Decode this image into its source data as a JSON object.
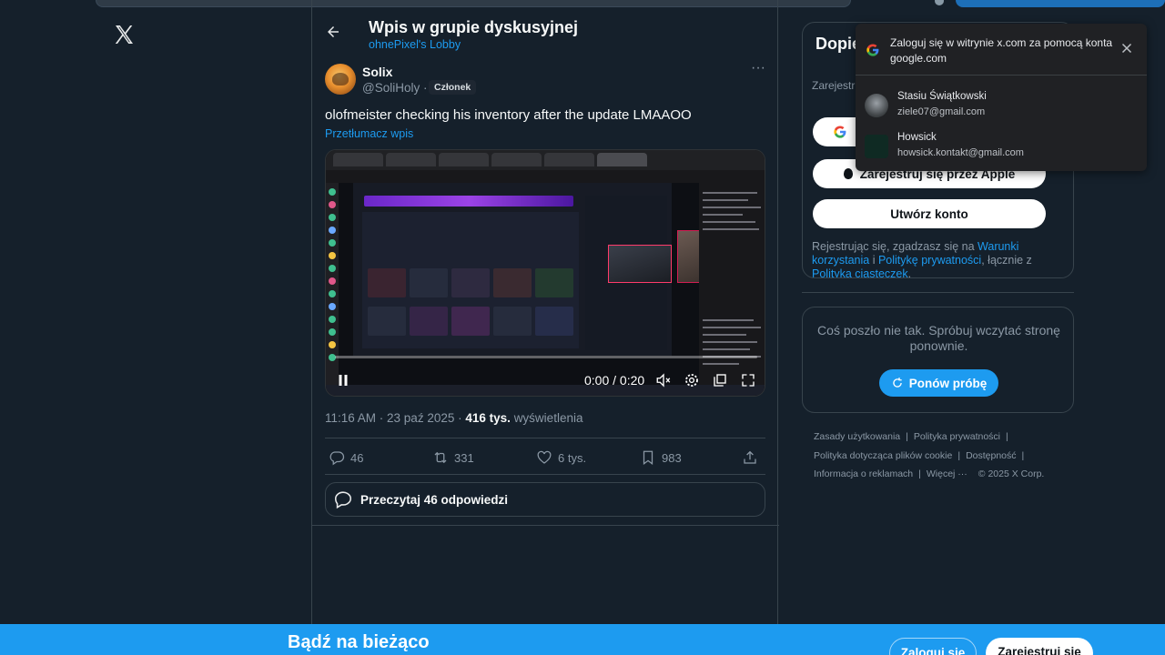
{
  "header": {
    "title": "Wpis w grupie dyskusyjnej",
    "subtitle": "ohnePixel's Lobby"
  },
  "tweet": {
    "author_name": "Solix",
    "author_handle": "@SoliHoly ·",
    "badge": "Członek",
    "text": "olofmeister checking his inventory after the update LMAAOO",
    "translate": "Przetłumacz wpis",
    "video": {
      "time": "0:00 / 0:20"
    },
    "timestamp": "11:16 AM · 23 paź 2025 ·",
    "views_count": "416 tys.",
    "views_label": "wyświetlenia",
    "actions": {
      "replies": "46",
      "reposts": "331",
      "likes": "6 tys.",
      "bookmarks": "983"
    },
    "read_replies": "Przeczytaj 46 odpowiedzi"
  },
  "signup": {
    "title": "Dopie serwi",
    "subtitle": "Zarejestr spersona",
    "apple_label": "Zarejestruj się przez Apple",
    "create_label": "Utwórz konto",
    "terms_prefix": "Rejestrując się, zgadzasz się na ",
    "terms_link1": "Warunki korzystania",
    "terms_mid1": " i ",
    "terms_link2": "Politykę prywatności",
    "terms_mid2": ", łącznie z ",
    "terms_link3": "Polityką ciasteczek",
    "terms_end": "."
  },
  "error_card": {
    "message": "Coś poszło nie tak. Spróbuj wczytać stronę ponownie.",
    "retry_label": "Ponów próbę"
  },
  "footer": {
    "terms": "Zasady użytkowania",
    "privacy": "Polityka prywatności",
    "cookies": "Polityka dotycząca plików cookie",
    "accessibility": "Dostępność",
    "ads": "Informacja o reklamach",
    "more": "Więcej ···",
    "copyright": "© 2025 X Corp."
  },
  "google_popup": {
    "heading": "Zaloguj się w witrynie x.com za pomocą konta google.com",
    "accounts": [
      {
        "name": "Stasiu Świątkowski",
        "email": "ziele07@gmail.com"
      },
      {
        "name": "Howsick",
        "email": "howsick.kontakt@gmail.com"
      }
    ]
  },
  "bottom_bar": {
    "title": "Bądź na bieżąco",
    "login_label": "Zaloguj się",
    "register_label": "Zarejestruj się"
  },
  "colors": {
    "background": "#15202b",
    "accent": "#1d9bf0",
    "border": "#38444d",
    "muted_text": "#8b98a5"
  }
}
